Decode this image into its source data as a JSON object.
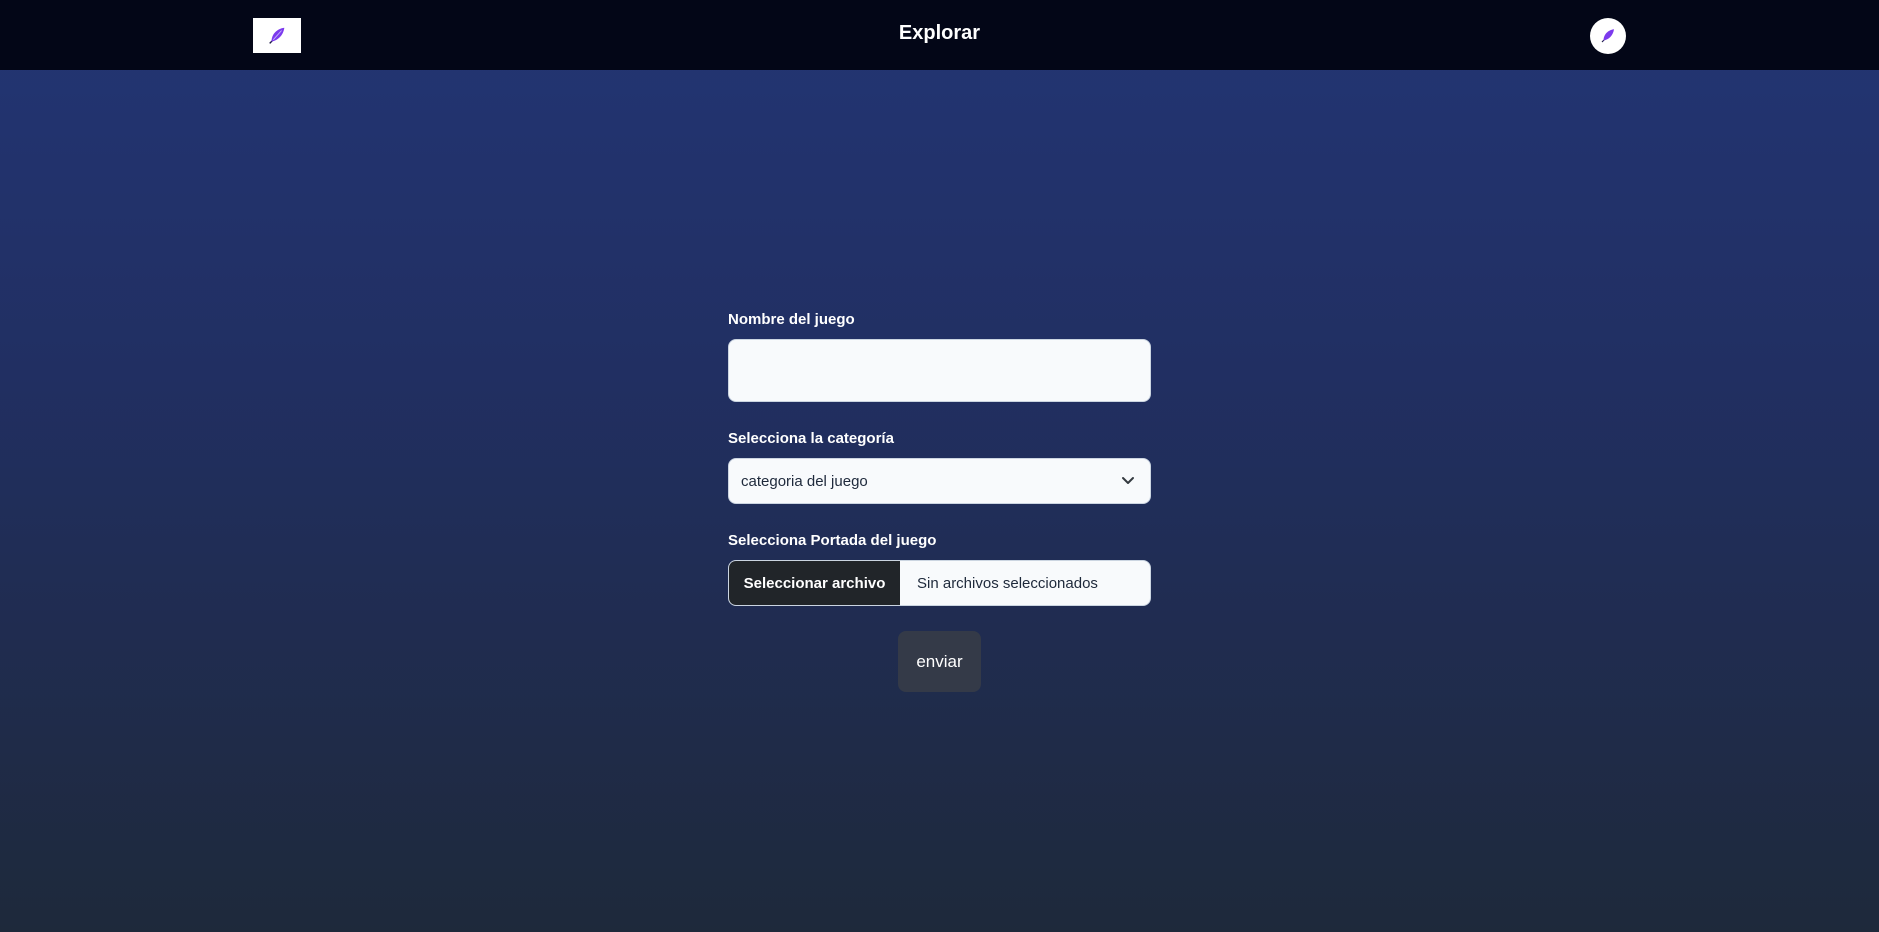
{
  "navbar": {
    "title": "Explorar",
    "logo_icon": "quill-pen-icon",
    "avatar_icon": "quill-pen-icon",
    "background": "#030617"
  },
  "form": {
    "name_label": "Nombre del juego",
    "name_value": "",
    "category_label": "Selecciona la categoría",
    "category_selected": "categoria del juego",
    "cover_label": "Selecciona Portada del juego",
    "file_button_label": "Seleccionar archivo",
    "file_status": "Sin archivos seleccionados",
    "submit_label": "enviar"
  },
  "colors": {
    "gradient_top": "#233574",
    "gradient_bottom": "#1e293b",
    "input_bg": "#f8fafc",
    "file_button_bg": "#212529",
    "submit_bg": "#343a48",
    "icon_purple": "#7c3aed"
  }
}
